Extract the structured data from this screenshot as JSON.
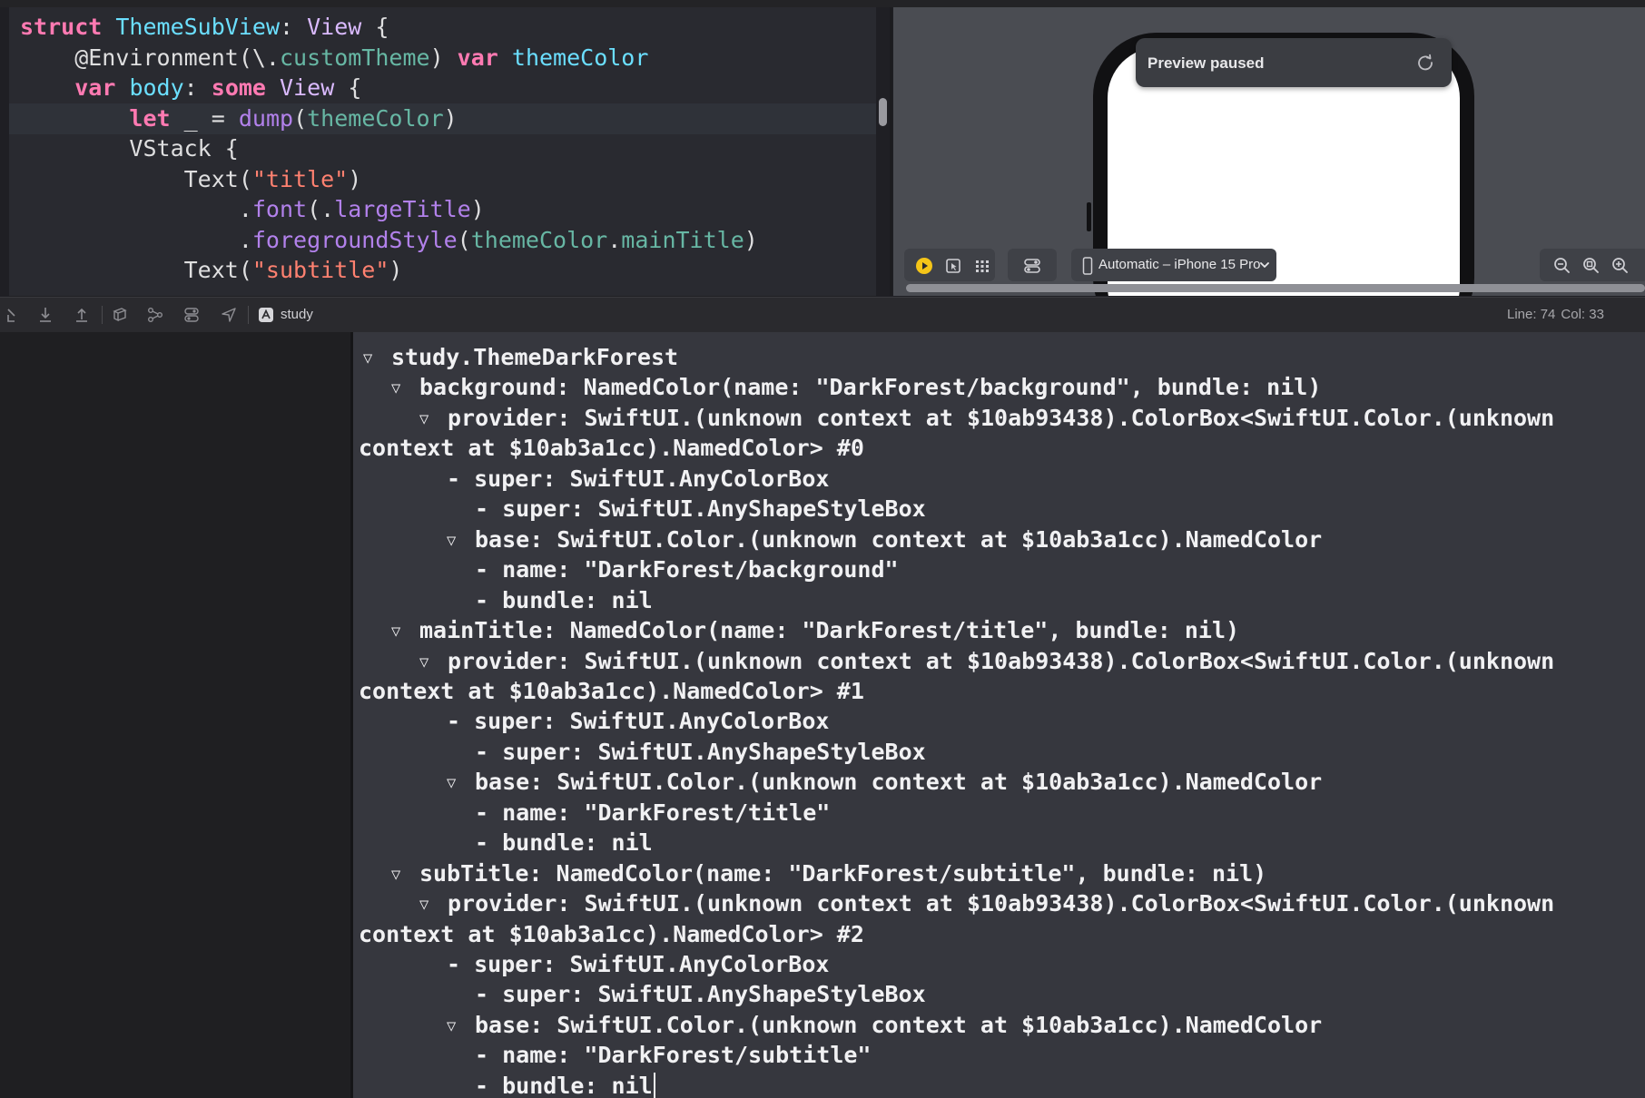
{
  "editor": {
    "lines": [
      [
        [
          "kw",
          "struct"
        ],
        [
          "pl",
          " "
        ],
        [
          "tp",
          "ThemeSubView"
        ],
        [
          "pl",
          ": "
        ],
        [
          "ty",
          "View"
        ],
        [
          "pl",
          " {"
        ]
      ],
      [
        [
          "pl",
          "    @Environment(\\."
        ],
        [
          "pr",
          "customTheme"
        ],
        [
          "pl",
          ") "
        ],
        [
          "kw",
          "var"
        ],
        [
          "pl",
          " "
        ],
        [
          "tp",
          "themeColor"
        ]
      ],
      [
        [
          "pl",
          "    "
        ],
        [
          "kw",
          "var"
        ],
        [
          "pl",
          " "
        ],
        [
          "tp",
          "body"
        ],
        [
          "pl",
          ": "
        ],
        [
          "kw",
          "some"
        ],
        [
          "pl",
          " "
        ],
        [
          "ty",
          "View"
        ],
        [
          "pl",
          " {"
        ]
      ],
      [
        [
          "pl",
          "        "
        ],
        [
          "kw",
          "let"
        ],
        [
          "pl",
          " _ = "
        ],
        [
          "fn",
          "dump"
        ],
        [
          "pl",
          "("
        ],
        [
          "pr",
          "themeColor"
        ],
        [
          "pl",
          ")"
        ]
      ],
      [
        [
          "pl",
          "        VStack {"
        ]
      ],
      [
        [
          "pl",
          "            Text("
        ],
        [
          "st",
          "\"title\""
        ],
        [
          "pl",
          ")"
        ]
      ],
      [
        [
          "pl",
          "                ."
        ],
        [
          "fn",
          "font"
        ],
        [
          "pl",
          "(."
        ],
        [
          "fn",
          "largeTitle"
        ],
        [
          "pl",
          ")"
        ]
      ],
      [
        [
          "pl",
          "                ."
        ],
        [
          "fn",
          "foregroundStyle"
        ],
        [
          "pl",
          "("
        ],
        [
          "pr",
          "themeColor"
        ],
        [
          "pl",
          "."
        ],
        [
          "pr",
          "mainTitle"
        ],
        [
          "pl",
          ")"
        ]
      ],
      [
        [
          "pl",
          "            Text("
        ],
        [
          "st",
          "\"subtitle\""
        ],
        [
          "pl",
          ")"
        ]
      ]
    ]
  },
  "preview": {
    "status": "Preview paused",
    "device_label": "Automatic – iPhone 15 Pro"
  },
  "debug_bar": {
    "target": "study",
    "line_label": "Line: 74",
    "col_label": "Col: 33"
  },
  "console": {
    "lines": [
      {
        "tri": true,
        "text": "study.ThemeDarkForest"
      },
      {
        "tri": true,
        "text": "background: NamedColor(name: \"DarkForest/background\", bundle: nil)"
      },
      {
        "tri": true,
        "text": "provider: SwiftUI.(unknown context at $10ab93438).ColorBox<SwiftUI.Color.(unknown"
      },
      {
        "tri": false,
        "text": "context at $10ab3a1cc).NamedColor> #0"
      },
      {
        "tri": false,
        "text": "- super: SwiftUI.AnyColorBox"
      },
      {
        "tri": false,
        "text": "- super: SwiftUI.AnyShapeStyleBox"
      },
      {
        "tri": true,
        "text": "base: SwiftUI.Color.(unknown context at $10ab3a1cc).NamedColor"
      },
      {
        "tri": false,
        "text": "- name: \"DarkForest/background\""
      },
      {
        "tri": false,
        "text": "- bundle: nil"
      },
      {
        "tri": true,
        "text": "mainTitle: NamedColor(name: \"DarkForest/title\", bundle: nil)"
      },
      {
        "tri": true,
        "text": "provider: SwiftUI.(unknown context at $10ab93438).ColorBox<SwiftUI.Color.(unknown"
      },
      {
        "tri": false,
        "text": "context at $10ab3a1cc).NamedColor> #1"
      },
      {
        "tri": false,
        "text": "- super: SwiftUI.AnyColorBox"
      },
      {
        "tri": false,
        "text": "- super: SwiftUI.AnyShapeStyleBox"
      },
      {
        "tri": true,
        "text": "base: SwiftUI.Color.(unknown context at $10ab3a1cc).NamedColor"
      },
      {
        "tri": false,
        "text": "- name: \"DarkForest/title\""
      },
      {
        "tri": false,
        "text": "- bundle: nil"
      },
      {
        "tri": true,
        "text": "subTitle: NamedColor(name: \"DarkForest/subtitle\", bundle: nil)"
      },
      {
        "tri": true,
        "text": "provider: SwiftUI.(unknown context at $10ab93438).ColorBox<SwiftUI.Color.(unknown"
      },
      {
        "tri": false,
        "text": "context at $10ab3a1cc).NamedColor> #2"
      },
      {
        "tri": false,
        "text": "- super: SwiftUI.AnyColorBox"
      },
      {
        "tri": false,
        "text": "- super: SwiftUI.AnyShapeStyleBox"
      },
      {
        "tri": true,
        "text": "base: SwiftUI.Color.(unknown context at $10ab3a1cc).NamedColor"
      },
      {
        "tri": false,
        "text": "- name: \"DarkForest/subtitle\""
      },
      {
        "tri": false,
        "text": "- bundle: nil"
      }
    ]
  }
}
